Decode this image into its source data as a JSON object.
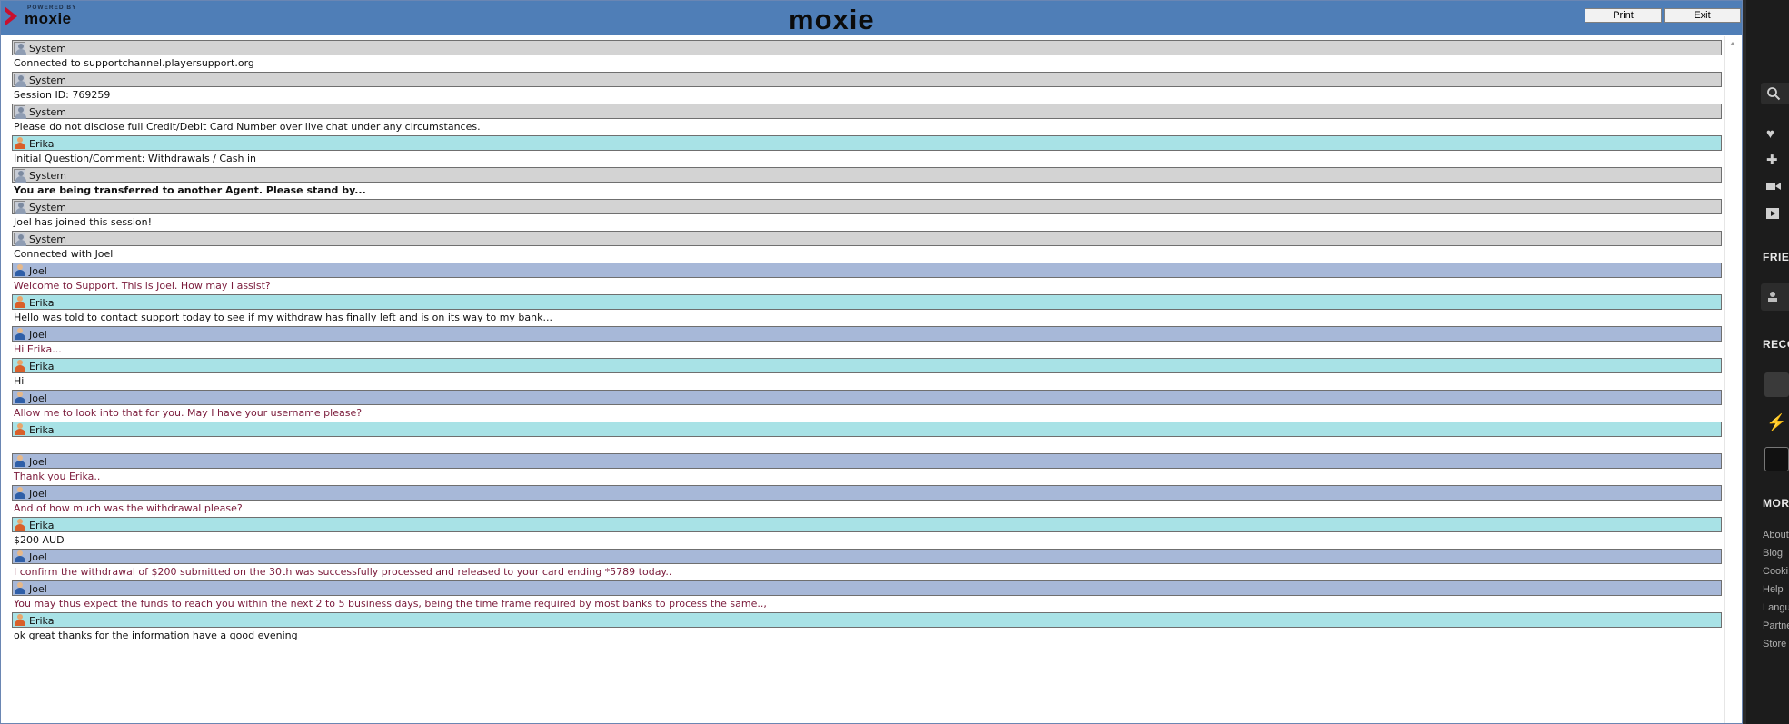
{
  "window": {
    "powered_by": "POWERED BY",
    "powered_brand": "moxie",
    "logo": "moxie",
    "print_label": "Print",
    "exit_label": "Exit"
  },
  "messages": [
    {
      "speaker": "System",
      "type": "system",
      "text": "Connected to supportchannel.playersupport.org"
    },
    {
      "speaker": "System",
      "type": "system",
      "text": "Session ID: 769259"
    },
    {
      "speaker": "System",
      "type": "system",
      "text": "Please do not disclose full Credit/Debit Card Number over live chat under any circumstances."
    },
    {
      "speaker": "Erika",
      "type": "erika",
      "text": "Initial Question/Comment: Withdrawals / Cash in"
    },
    {
      "speaker": "System",
      "type": "system",
      "text": "You are being transferred to another Agent. Please stand by...",
      "bold": true
    },
    {
      "speaker": "System",
      "type": "system",
      "text": "Joel has joined this session!"
    },
    {
      "speaker": "System",
      "type": "system",
      "text": "Connected with Joel"
    },
    {
      "speaker": "Joel",
      "type": "joel",
      "text": "Welcome to Support. This is Joel. How may I assist?"
    },
    {
      "speaker": "Erika",
      "type": "erika",
      "text": "Hello was told to contact support today to see if my withdraw has finally left and is on its way to my bank..."
    },
    {
      "speaker": "Joel",
      "type": "joel",
      "text": "Hi Erika..."
    },
    {
      "speaker": "Erika",
      "type": "erika",
      "text": "Hi"
    },
    {
      "speaker": "Joel",
      "type": "joel",
      "text": "Allow me to look into that for you. May I have your username please?"
    },
    {
      "speaker": "Erika",
      "type": "erika",
      "text": ""
    },
    {
      "speaker": "Joel",
      "type": "joel",
      "text": "Thank you Erika.."
    },
    {
      "speaker": "Joel",
      "type": "joel",
      "text": "And of how much was the withdrawal please?"
    },
    {
      "speaker": "Erika",
      "type": "erika",
      "text": "$200 AUD"
    },
    {
      "speaker": "Joel",
      "type": "joel",
      "text": "I confirm the withdrawal of $200 submitted on the 30th was successfully processed and released to your card ending *5789 today.."
    },
    {
      "speaker": "Joel",
      "type": "joel",
      "text": "You may thus expect the funds to reach you within the next 2 to 5 business days, being the time frame required by most banks to process the same..,"
    },
    {
      "speaker": "Erika",
      "type": "erika",
      "text": "ok great thanks for the information have a good evening"
    }
  ],
  "sidebar": {
    "friends_heading": "FRIE",
    "recent_heading": "RECO",
    "more_heading": "MORI",
    "links": [
      "About",
      "Blog",
      "Cooki",
      "Help",
      "Langu",
      "Partne",
      "Store"
    ],
    "icons": [
      "search-icon",
      "heart-icon",
      "gamepad-icon",
      "video-icon",
      "play-icon",
      "user-icon",
      "lightning-icon"
    ]
  }
}
